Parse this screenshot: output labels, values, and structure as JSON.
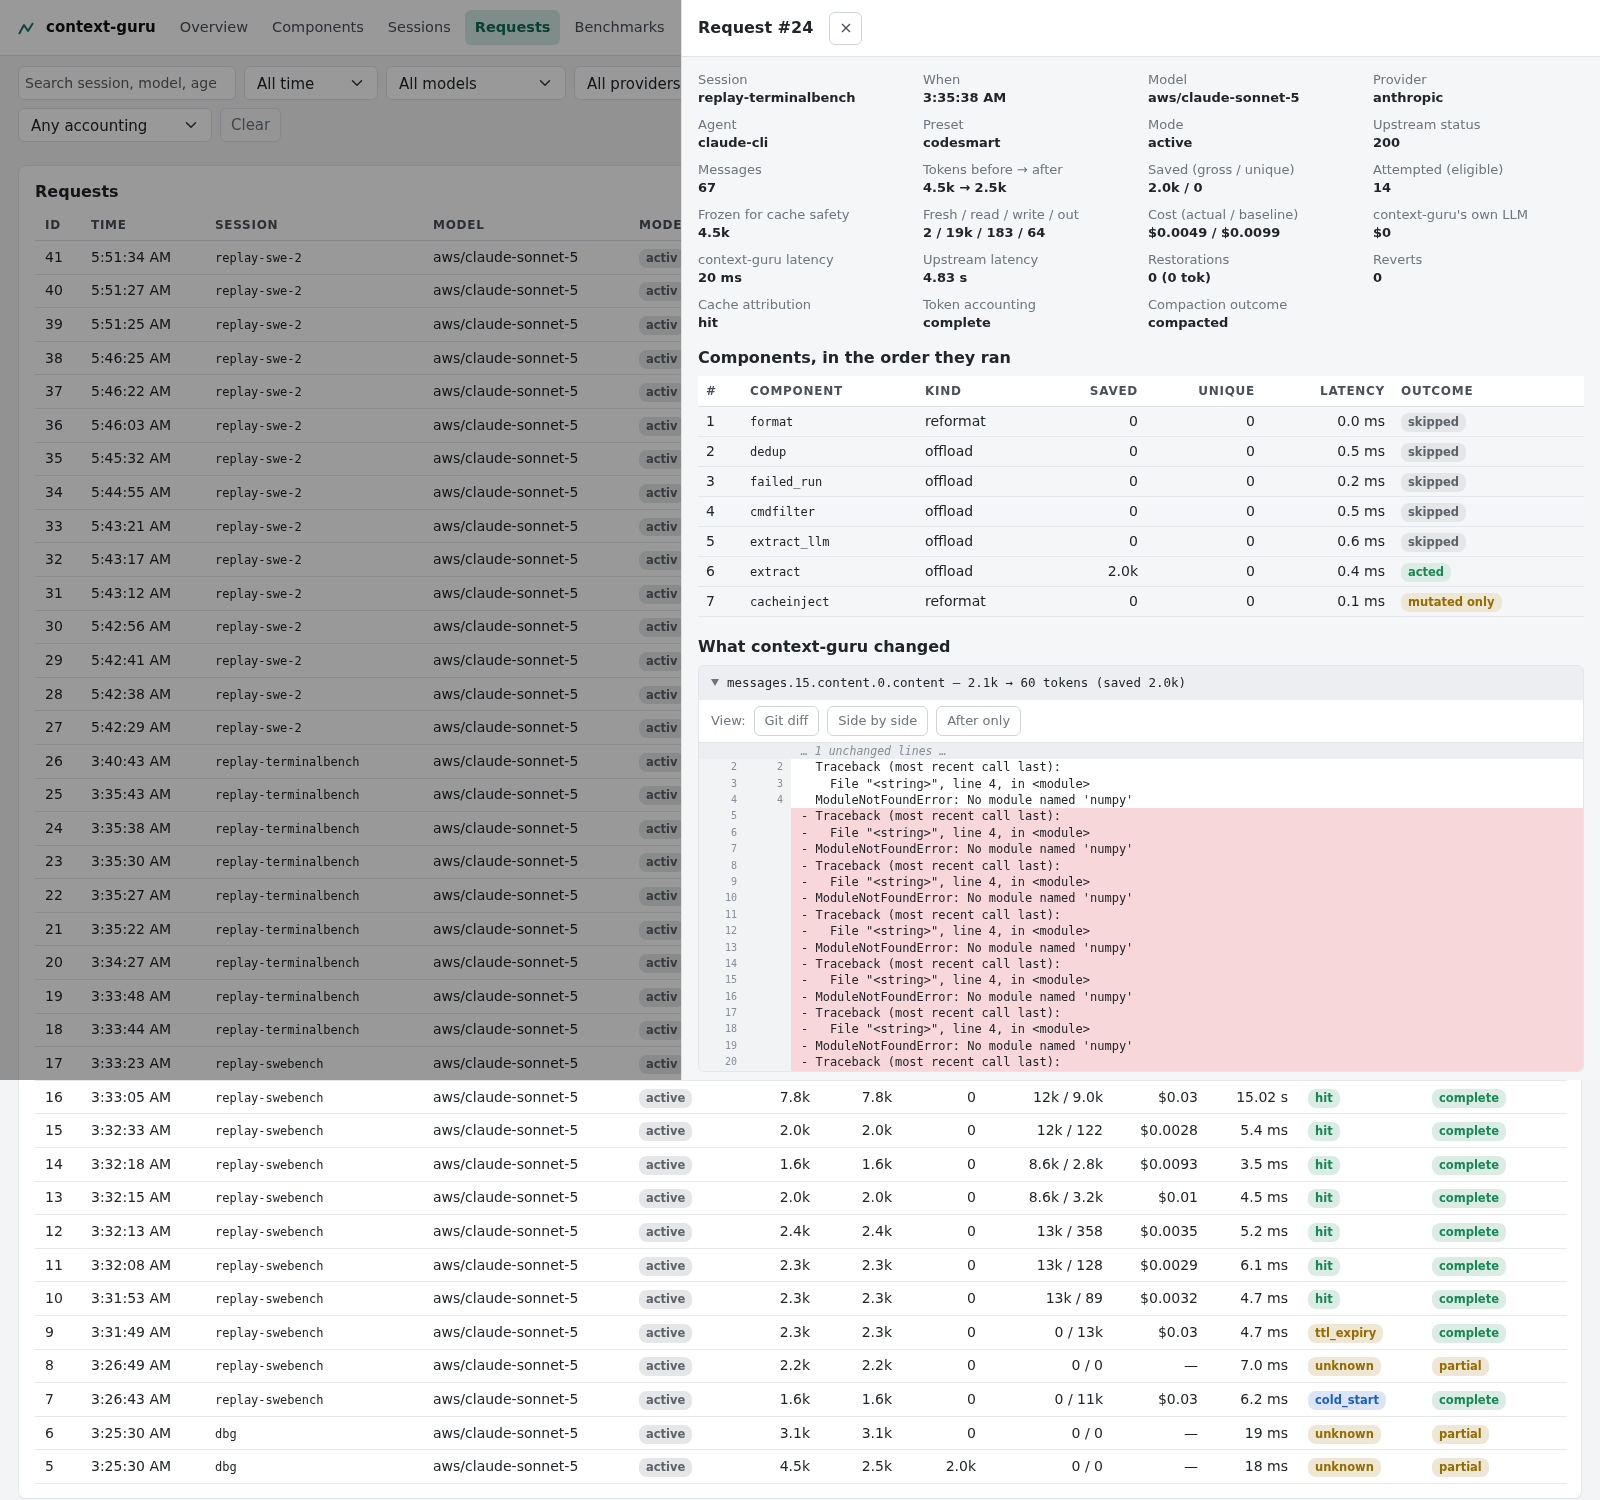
{
  "navbar": {
    "brand": "context-guru",
    "links": [
      {
        "label": "Overview",
        "selected": false
      },
      {
        "label": "Components",
        "selected": false
      },
      {
        "label": "Sessions",
        "selected": false
      },
      {
        "label": "Requests",
        "selected": true
      },
      {
        "label": "Benchmarks",
        "selected": false
      }
    ]
  },
  "filters": {
    "search": {
      "placeholder": "Search session, model, age"
    },
    "selects": [
      "All time",
      "All models",
      "All providers",
      "Any accounting"
    ],
    "clear_button": "Clear"
  },
  "requests": {
    "title": "Requests",
    "columns": [
      "ID",
      "TIME",
      "SESSION",
      "MODEL",
      "MODE"
    ],
    "rows": [
      {
        "cells": [
          "41",
          "5:51:34 AM",
          "replay-swe-2",
          "aws/claude-sonnet-5",
          {
            "text": "activ",
            "color": "#5c636a"
          }
        ]
      },
      {
        "cells": [
          "40",
          "5:51:27 AM",
          "replay-swe-2",
          "aws/claude-sonnet-5",
          {
            "text": "activ",
            "color": "#5c636a"
          }
        ]
      },
      {
        "cells": [
          "39",
          "5:51:25 AM",
          "replay-swe-2",
          "aws/claude-sonnet-5",
          {
            "text": "activ",
            "color": "#5c636a"
          }
        ]
      },
      {
        "cells": [
          "38",
          "5:46:25 AM",
          "replay-swe-2",
          "aws/claude-sonnet-5",
          {
            "text": "activ",
            "color": "#5c636a"
          }
        ]
      },
      {
        "cells": [
          "37",
          "5:46:22 AM",
          "replay-swe-2",
          "aws/claude-sonnet-5",
          {
            "text": "activ",
            "color": "#5c636a"
          }
        ]
      },
      {
        "cells": [
          "36",
          "5:46:03 AM",
          "replay-swe-2",
          "aws/claude-sonnet-5",
          {
            "text": "activ",
            "color": "#5c636a"
          }
        ]
      },
      {
        "cells": [
          "35",
          "5:45:32 AM",
          "replay-swe-2",
          "aws/claude-sonnet-5",
          {
            "text": "activ",
            "color": "#5c636a"
          }
        ]
      },
      {
        "cells": [
          "34",
          "5:44:55 AM",
          "replay-swe-2",
          "aws/claude-sonnet-5",
          {
            "text": "activ",
            "color": "#5c636a"
          }
        ]
      },
      {
        "cells": [
          "33",
          "5:43:21 AM",
          "replay-swe-2",
          "aws/claude-sonnet-5",
          {
            "text": "activ",
            "color": "#5c636a"
          }
        ]
      },
      {
        "cells": [
          "32",
          "5:43:17 AM",
          "replay-swe-2",
          "aws/claude-sonnet-5",
          {
            "text": "activ",
            "color": "#5c636a"
          }
        ]
      },
      {
        "cells": [
          "31",
          "5:43:12 AM",
          "replay-swe-2",
          "aws/claude-sonnet-5",
          {
            "text": "activ",
            "color": "#5c636a"
          }
        ]
      },
      {
        "cells": [
          "30",
          "5:42:56 AM",
          "replay-swe-2",
          "aws/claude-sonnet-5",
          {
            "text": "activ",
            "color": "#5c636a"
          }
        ]
      },
      {
        "cells": [
          "29",
          "5:42:41 AM",
          "replay-swe-2",
          "aws/claude-sonnet-5",
          {
            "text": "activ",
            "color": "#5c636a"
          }
        ]
      },
      {
        "cells": [
          "28",
          "5:42:38 AM",
          "replay-swe-2",
          "aws/claude-sonnet-5",
          {
            "text": "activ",
            "color": "#5c636a"
          }
        ]
      },
      {
        "cells": [
          "27",
          "5:42:29 AM",
          "replay-swe-2",
          "aws/claude-sonnet-5",
          {
            "text": "activ",
            "color": "#5c636a"
          }
        ]
      },
      {
        "cells": [
          "26",
          "3:40:43 AM",
          "replay-terminalbench",
          "aws/claude-sonnet-5",
          {
            "text": "activ",
            "color": "#5c636a"
          }
        ]
      },
      {
        "cells": [
          "25",
          "3:35:43 AM",
          "replay-terminalbench",
          "aws/claude-sonnet-5",
          {
            "text": "activ",
            "color": "#5c636a"
          }
        ]
      },
      {
        "cells": [
          "24",
          "3:35:38 AM",
          "replay-terminalbench",
          "aws/claude-sonnet-5",
          {
            "text": "activ",
            "color": "#5c636a"
          }
        ]
      },
      {
        "cells": [
          "23",
          "3:35:30 AM",
          "replay-terminalbench",
          "aws/claude-sonnet-5",
          {
            "text": "activ",
            "color": "#5c636a"
          }
        ]
      },
      {
        "cells": [
          "22",
          "3:35:27 AM",
          "replay-terminalbench",
          "aws/claude-sonnet-5",
          {
            "text": "activ",
            "color": "#5c636a"
          }
        ]
      },
      {
        "cells": [
          "21",
          "3:35:22 AM",
          "replay-terminalbench",
          "aws/claude-sonnet-5",
          {
            "text": "activ",
            "color": "#5c636a"
          }
        ]
      },
      {
        "cells": [
          "20",
          "3:34:27 AM",
          "replay-terminalbench",
          "aws/claude-sonnet-5",
          {
            "text": "activ",
            "color": "#5c636a"
          }
        ]
      },
      {
        "cells": [
          "19",
          "3:33:48 AM",
          "replay-terminalbench",
          "aws/claude-sonnet-5",
          {
            "text": "activ",
            "color": "#5c636a"
          }
        ]
      },
      {
        "cells": [
          "18",
          "3:33:44 AM",
          "replay-terminalbench",
          "aws/claude-sonnet-5",
          {
            "text": "activ",
            "color": "#5c636a"
          }
        ]
      },
      {
        "cells": [
          "17",
          "3:33:23 AM",
          "replay-swebench",
          "aws/claude-sonnet-5",
          {
            "text": "activ",
            "color": "#5c636a"
          }
        ]
      },
      {
        "cells": [
          "16",
          "3:33:05 AM",
          "replay-swebench",
          "aws/claude-sonnet-5",
          {
            "text": "active",
            "color": "#5c636a"
          },
          "7.8k",
          "7.8k",
          "0",
          "12k / 9.0k",
          "$0.03",
          "15.02 s",
          {
            "text": "hit",
            "color": "#198754"
          },
          {
            "text": "complete",
            "color": "#198754"
          }
        ]
      },
      {
        "cells": [
          "15",
          "3:32:33 AM",
          "replay-swebench",
          "aws/claude-sonnet-5",
          {
            "text": "active",
            "color": "#5c636a"
          },
          "2.0k",
          "2.0k",
          "0",
          "12k / 122",
          "$0.0028",
          "5.4 ms",
          {
            "text": "hit",
            "color": "#198754"
          },
          {
            "text": "complete",
            "color": "#198754"
          }
        ]
      },
      {
        "cells": [
          "14",
          "3:32:18 AM",
          "replay-swebench",
          "aws/claude-sonnet-5",
          {
            "text": "active",
            "color": "#5c636a"
          },
          "1.6k",
          "1.6k",
          "0",
          "8.6k / 2.8k",
          "$0.0093",
          "3.5 ms",
          {
            "text": "hit",
            "color": "#198754"
          },
          {
            "text": "complete",
            "color": "#198754"
          }
        ]
      },
      {
        "cells": [
          "13",
          "3:32:15 AM",
          "replay-swebench",
          "aws/claude-sonnet-5",
          {
            "text": "active",
            "color": "#5c636a"
          },
          "2.0k",
          "2.0k",
          "0",
          "8.6k / 3.2k",
          "$0.01",
          "4.5 ms",
          {
            "text": "hit",
            "color": "#198754"
          },
          {
            "text": "complete",
            "color": "#198754"
          }
        ]
      },
      {
        "cells": [
          "12",
          "3:32:13 AM",
          "replay-swebench",
          "aws/claude-sonnet-5",
          {
            "text": "active",
            "color": "#5c636a"
          },
          "2.4k",
          "2.4k",
          "0",
          "13k / 358",
          "$0.0035",
          "5.2 ms",
          {
            "text": "hit",
            "color": "#198754"
          },
          {
            "text": "complete",
            "color": "#198754"
          }
        ]
      },
      {
        "cells": [
          "11",
          "3:32:08 AM",
          "replay-swebench",
          "aws/claude-sonnet-5",
          {
            "text": "active",
            "color": "#5c636a"
          },
          "2.3k",
          "2.3k",
          "0",
          "13k / 128",
          "$0.0029",
          "6.1 ms",
          {
            "text": "hit",
            "color": "#198754"
          },
          {
            "text": "complete",
            "color": "#198754"
          }
        ]
      },
      {
        "cells": [
          "10",
          "3:31:53 AM",
          "replay-swebench",
          "aws/claude-sonnet-5",
          {
            "text": "active",
            "color": "#5c636a"
          },
          "2.3k",
          "2.3k",
          "0",
          "13k / 89",
          "$0.0032",
          "4.7 ms",
          {
            "text": "hit",
            "color": "#198754"
          },
          {
            "text": "complete",
            "color": "#198754"
          }
        ]
      },
      {
        "cells": [
          "9",
          "3:31:49 AM",
          "replay-swebench",
          "aws/claude-sonnet-5",
          {
            "text": "active",
            "color": "#5c636a"
          },
          "2.3k",
          "2.3k",
          "0",
          "0 / 13k",
          "$0.03",
          "4.7 ms",
          {
            "text": "ttl_expiry",
            "color": "#946c00"
          },
          {
            "text": "complete",
            "color": "#198754"
          }
        ]
      },
      {
        "cells": [
          "8",
          "3:26:49 AM",
          "replay-swebench",
          "aws/claude-sonnet-5",
          {
            "text": "active",
            "color": "#5c636a"
          },
          "2.2k",
          "2.2k",
          "0",
          "0 / 0",
          "—",
          "7.0 ms",
          {
            "text": "unknown",
            "color": "#946c00"
          },
          {
            "text": "partial",
            "color": "#946c00"
          }
        ]
      },
      {
        "cells": [
          "7",
          "3:26:43 AM",
          "replay-swebench",
          "aws/claude-sonnet-5",
          {
            "text": "active",
            "color": "#5c636a"
          },
          "1.6k",
          "1.6k",
          "0",
          "0 / 11k",
          "$0.03",
          "6.2 ms",
          {
            "text": "cold_start",
            "color": "#1d5fbf"
          },
          {
            "text": "complete",
            "color": "#198754"
          }
        ]
      },
      {
        "cells": [
          "6",
          "3:25:30 AM",
          "dbg",
          "aws/claude-sonnet-5",
          {
            "text": "active",
            "color": "#5c636a"
          },
          "3.1k",
          "3.1k",
          "0",
          "0 / 0",
          "—",
          "19 ms",
          {
            "text": "unknown",
            "color": "#946c00"
          },
          {
            "text": "partial",
            "color": "#946c00"
          }
        ]
      },
      {
        "cells": [
          "5",
          "3:25:30 AM",
          "dbg",
          "aws/claude-sonnet-5",
          {
            "text": "active",
            "color": "#5c636a"
          },
          "4.5k",
          "2.5k",
          "2.0k",
          "0 / 0",
          "—",
          "18 ms",
          {
            "text": "unknown",
            "color": "#946c00"
          },
          {
            "text": "partial",
            "color": "#946c00"
          }
        ]
      }
    ]
  },
  "detail_panel": {
    "title": "Request #24",
    "fields": [
      {
        "label": "Session",
        "value": "replay-terminalbench"
      },
      {
        "label": "When",
        "value": "3:35:38 AM"
      },
      {
        "label": "Model",
        "value": "aws/claude-sonnet-5"
      },
      {
        "label": "Provider",
        "value": "anthropic"
      },
      {
        "label": "Agent",
        "value": "claude-cli"
      },
      {
        "label": "Preset",
        "value": "codesmart"
      },
      {
        "label": "Mode",
        "value": "active"
      },
      {
        "label": "Upstream status",
        "value": "200"
      },
      {
        "label": "Messages",
        "value": "67"
      },
      {
        "label": "Tokens before → after",
        "value": "4.5k → 2.5k"
      },
      {
        "label": "Saved (gross / unique)",
        "value": "2.0k / 0"
      },
      {
        "label": "Attempted (eligible)",
        "value": "14"
      },
      {
        "label": "Frozen for cache safety",
        "value": "4.5k"
      },
      {
        "label": "Fresh / read / write / out",
        "value": "2 / 19k / 183 / 64"
      },
      {
        "label": "Cost (actual / baseline)",
        "value": "$0.0049 / $0.0099"
      },
      {
        "label": "context-guru's own LLM",
        "value": "$0"
      },
      {
        "label": "context-guru latency",
        "value": "20 ms"
      },
      {
        "label": "Upstream latency",
        "value": "4.83 s"
      },
      {
        "label": "Restorations",
        "value": "0 (0 tok)"
      },
      {
        "label": "Reverts",
        "value": "0"
      },
      {
        "label": "Cache attribution",
        "value": "hit"
      },
      {
        "label": "Token accounting",
        "value": "complete"
      },
      {
        "label": "Compaction outcome",
        "value": "compacted"
      }
    ],
    "components": {
      "title": "Components, in the order they ran",
      "columns": [
        "#",
        "COMPONENT",
        "KIND",
        "SAVED",
        "UNIQUE",
        "LATENCY",
        "OUTCOME"
      ],
      "rows": [
        {
          "n": "1",
          "component": "format",
          "component_kind": "reformat",
          "saved": "0",
          "unique": "0",
          "latency": "0.0 ms",
          "outcome": {
            "text": "skipped",
            "color": "#5c636a"
          }
        },
        {
          "n": "2",
          "component": "dedup",
          "component_kind": "offload",
          "saved": "0",
          "unique": "0",
          "latency": "0.5 ms",
          "outcome": {
            "text": "skipped",
            "color": "#5c636a"
          }
        },
        {
          "n": "3",
          "component": "failed_run",
          "component_kind": "offload",
          "saved": "0",
          "unique": "0",
          "latency": "0.2 ms",
          "outcome": {
            "text": "skipped",
            "color": "#5c636a"
          }
        },
        {
          "n": "4",
          "component": "cmdfilter",
          "component_kind": "offload",
          "saved": "0",
          "unique": "0",
          "latency": "0.5 ms",
          "outcome": {
            "text": "skipped",
            "color": "#5c636a"
          }
        },
        {
          "n": "5",
          "component": "extract_llm",
          "component_kind": "offload",
          "saved": "0",
          "unique": "0",
          "latency": "0.6 ms",
          "outcome": {
            "text": "skipped",
            "color": "#5c636a"
          }
        },
        {
          "n": "6",
          "component": "extract",
          "component_kind": "offload",
          "saved": "2.0k",
          "unique": "0",
          "latency": "0.4 ms",
          "outcome": {
            "text": "acted",
            "color": "#198754"
          }
        },
        {
          "n": "7",
          "component": "cacheinject",
          "component_kind": "reformat",
          "saved": "0",
          "unique": "0",
          "latency": "0.1 ms",
          "outcome": {
            "text": "mutated only",
            "color": "#946c00"
          }
        }
      ]
    },
    "changes": {
      "title": "What context-guru changed",
      "entry": {
        "summary": "messages.15.content.0.content — 2.1k → 60 tokens (saved 2.0k)",
        "expanded": true,
        "view_label": "View:",
        "views": [
          {
            "label": "Git diff",
            "selected": false
          },
          {
            "label": "Side by side",
            "selected": false
          },
          {
            "label": "After only",
            "selected": false
          }
        ],
        "lines": [
          {
            "kind": "hunk",
            "text": "… 1 unchanged lines …"
          },
          {
            "kind": "context",
            "old": "2",
            "new": "2",
            "text": "  Traceback (most recent call last):"
          },
          {
            "kind": "context",
            "old": "3",
            "new": "3",
            "text": "    File \"<string>\", line 4, in <module>"
          },
          {
            "kind": "context",
            "old": "4",
            "new": "4",
            "text": "  ModuleNotFoundError: No module named 'numpy'"
          },
          {
            "kind": "removed",
            "old": "5",
            "text": "- Traceback (most recent call last):"
          },
          {
            "kind": "removed",
            "old": "6",
            "text": "-   File \"<string>\", line 4, in <module>"
          },
          {
            "kind": "removed",
            "old": "7",
            "text": "- ModuleNotFoundError: No module named 'numpy'"
          },
          {
            "kind": "removed",
            "old": "8",
            "text": "- Traceback (most recent call last):"
          },
          {
            "kind": "removed",
            "old": "9",
            "text": "-   File \"<string>\", line 4, in <module>"
          },
          {
            "kind": "removed",
            "old": "10",
            "text": "- ModuleNotFoundError: No module named 'numpy'"
          },
          {
            "kind": "removed",
            "old": "11",
            "text": "- Traceback (most recent call last):"
          },
          {
            "kind": "removed",
            "old": "12",
            "text": "-   File \"<string>\", line 4, in <module>"
          },
          {
            "kind": "removed",
            "old": "13",
            "text": "- ModuleNotFoundError: No module named 'numpy'"
          },
          {
            "kind": "removed",
            "old": "14",
            "text": "- Traceback (most recent call last):"
          },
          {
            "kind": "removed",
            "old": "15",
            "text": "-   File \"<string>\", line 4, in <module>"
          },
          {
            "kind": "removed",
            "old": "16",
            "text": "- ModuleNotFoundError: No module named 'numpy'"
          },
          {
            "kind": "removed",
            "old": "17",
            "text": "- Traceback (most recent call last):"
          },
          {
            "kind": "removed",
            "old": "18",
            "text": "-   File \"<string>\", line 4, in <module>"
          },
          {
            "kind": "removed",
            "old": "19",
            "text": "- ModuleNotFoundError: No module named 'numpy'"
          },
          {
            "kind": "removed",
            "old": "20",
            "text": "- Traceback (most recent call last):"
          }
        ]
      }
    }
  }
}
